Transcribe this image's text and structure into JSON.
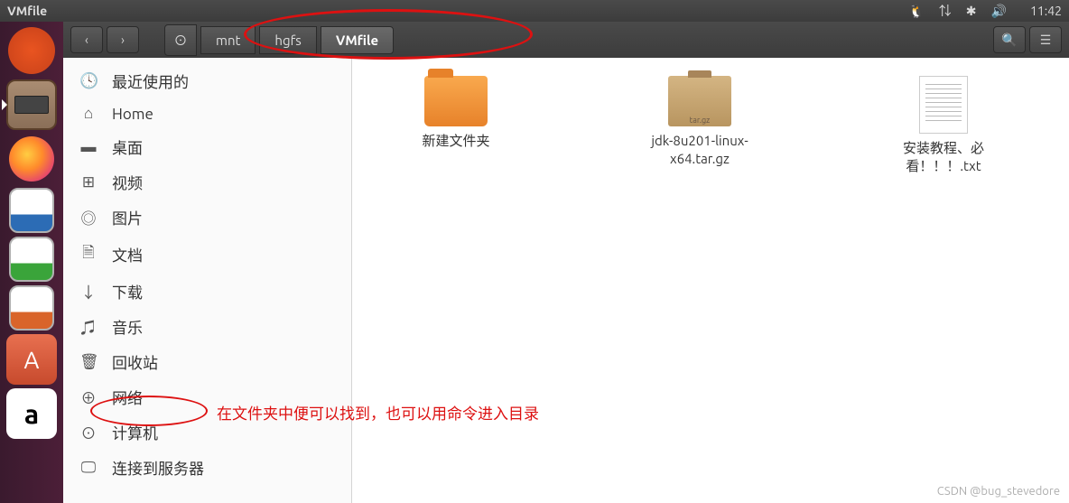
{
  "topbar": {
    "title": "VMfile",
    "clock": "11:42"
  },
  "launcher": {
    "ubuntu": "ubuntu-dash",
    "files": "files",
    "firefox": "firefox",
    "writer": "libreoffice-writer",
    "calc": "libreoffice-calc",
    "impress": "libreoffice-impress",
    "software": "ubuntu-software",
    "amazon": "amazon"
  },
  "toolbar": {
    "back": "‹",
    "forward": "›",
    "path": [
      "mnt",
      "hgfs",
      "VMfile"
    ]
  },
  "sidebar": {
    "items": [
      {
        "icon": "🕓",
        "label": "最近使用的"
      },
      {
        "icon": "⌂",
        "label": "Home"
      },
      {
        "icon": "▬",
        "label": "桌面"
      },
      {
        "icon": "⊞",
        "label": "视频"
      },
      {
        "icon": "◎",
        "label": "图片"
      },
      {
        "icon": "🗎",
        "label": "文档"
      },
      {
        "icon": "↓",
        "label": "下载"
      },
      {
        "icon": "♫",
        "label": "音乐"
      },
      {
        "icon": "🗑",
        "label": "回收站"
      },
      {
        "icon": "⊕",
        "label": "网络"
      },
      {
        "icon": "⊙",
        "label": "计算机"
      },
      {
        "icon": "🖵",
        "label": "连接到服务器"
      }
    ]
  },
  "files": {
    "items": [
      {
        "type": "folder",
        "label": "新建文件夹"
      },
      {
        "type": "targz",
        "label": "jdk-8u201-linux-x64.tar.gz",
        "badge": "tar.gz"
      },
      {
        "type": "txt",
        "label": "安装教程、必看！！！.txt"
      }
    ]
  },
  "annotations": {
    "text1": "在文件夹中便可以找到，也可以用命令进入目录"
  },
  "watermark": "CSDN @bug_stevedore"
}
